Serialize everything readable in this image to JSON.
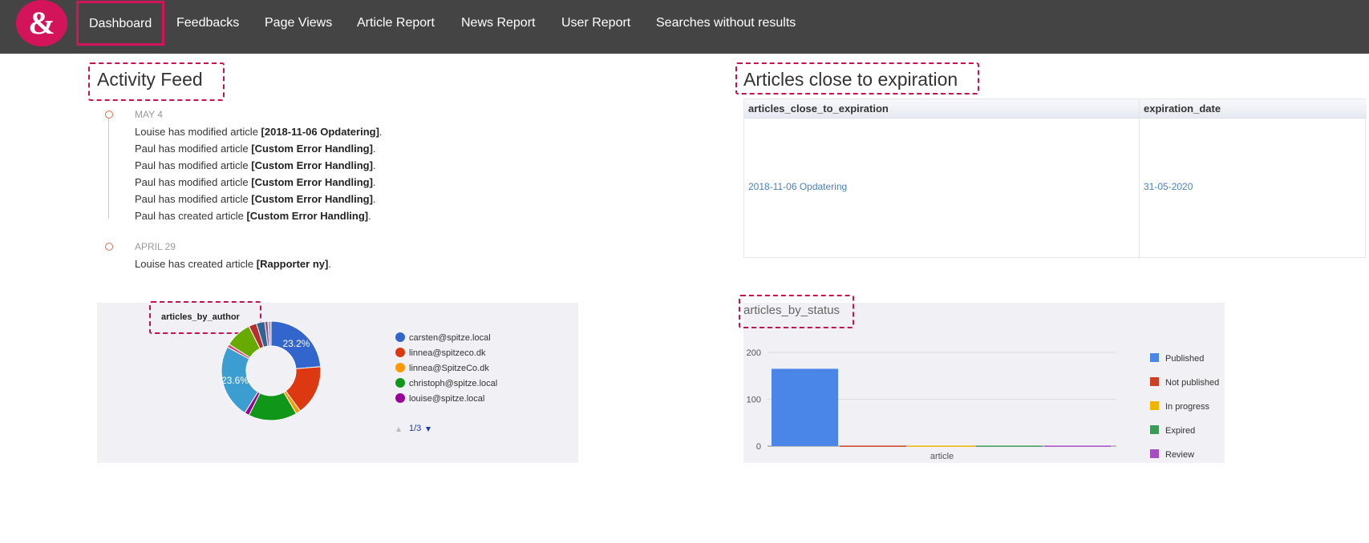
{
  "nav": {
    "logo_glyph": "&",
    "items": [
      "Dashboard",
      "Feedbacks",
      "Page Views",
      "Article Report",
      "News Report",
      "User Report",
      "Searches without results"
    ]
  },
  "activity": {
    "title": "Activity Feed",
    "groups": [
      {
        "date": "MAY 4",
        "entries": [
          {
            "text": "Louise has modified article ",
            "article": "[2018-11-06 Opdatering]",
            "end": "."
          },
          {
            "text": "Paul has modified article ",
            "article": "[Custom Error Handling]",
            "end": "."
          },
          {
            "text": "Paul has modified article ",
            "article": "[Custom Error Handling]",
            "end": "."
          },
          {
            "text": "Paul has modified article ",
            "article": "[Custom Error Handling]",
            "end": "."
          },
          {
            "text": "Paul has modified article ",
            "article": "[Custom Error Handling]",
            "end": "."
          },
          {
            "text": "Paul has created article ",
            "article": "[Custom Error Handling]",
            "end": "."
          }
        ]
      },
      {
        "date": "APRIL 29",
        "entries": [
          {
            "text": "Louise has created article ",
            "article": "[Rapporter ny]",
            "end": "."
          }
        ]
      }
    ]
  },
  "expiration": {
    "title": "Articles close to expiration",
    "columns": [
      "articles_close_to_expiration",
      "expiration_date"
    ],
    "rows": [
      [
        "2018-11-06 Opdatering",
        "31-05-2020"
      ]
    ]
  },
  "chart_data": [
    {
      "type": "pie",
      "title": "articles_by_author",
      "donut": true,
      "slices": [
        {
          "label": "carsten@spitze.local",
          "value": 23.2,
          "color": "#3366cc"
        },
        {
          "label": "linnea@spitzeco.dk",
          "value": 16.0,
          "color": "#dc3912"
        },
        {
          "label": "linnea@SpitzeCo.dk",
          "value": 1.5,
          "color": "#ff9900"
        },
        {
          "label": "christoph@spitze.local",
          "value": 15.5,
          "color": "#109618"
        },
        {
          "label": "louise@spitze.local",
          "value": 1.5,
          "color": "#990099"
        },
        {
          "label": "",
          "value": 23.6,
          "color": "#3b9dd0"
        },
        {
          "label": "",
          "value": 1.0,
          "color": "#dd4477"
        },
        {
          "label": "",
          "value": 8.5,
          "color": "#66aa00"
        },
        {
          "label": "",
          "value": 2.5,
          "color": "#b82e2e"
        },
        {
          "label": "",
          "value": 2.7,
          "color": "#316395"
        },
        {
          "label": "",
          "value": 1.0,
          "color": "#994499"
        },
        {
          "label": "",
          "value": 1.0,
          "color": "#aaaaaa"
        }
      ],
      "slice_labels": [
        "23.2%",
        "23.6%"
      ],
      "legend_visible": 5,
      "pager": "1/3"
    },
    {
      "type": "bar",
      "title": "articles_by_status",
      "categories": [
        "article"
      ],
      "series": [
        {
          "name": "Published",
          "values": [
            165
          ],
          "color": "#4a86e8"
        },
        {
          "name": "Not published",
          "values": [
            1
          ],
          "color": "#cc4125"
        },
        {
          "name": "In progress",
          "values": [
            1
          ],
          "color": "#f1b400"
        },
        {
          "name": "Expired",
          "values": [
            1
          ],
          "color": "#3d9a56"
        },
        {
          "name": "Review",
          "values": [
            1
          ],
          "color": "#a64dc4"
        }
      ],
      "ylim": [
        0,
        200
      ],
      "yticks": [
        0,
        100,
        200
      ]
    }
  ]
}
